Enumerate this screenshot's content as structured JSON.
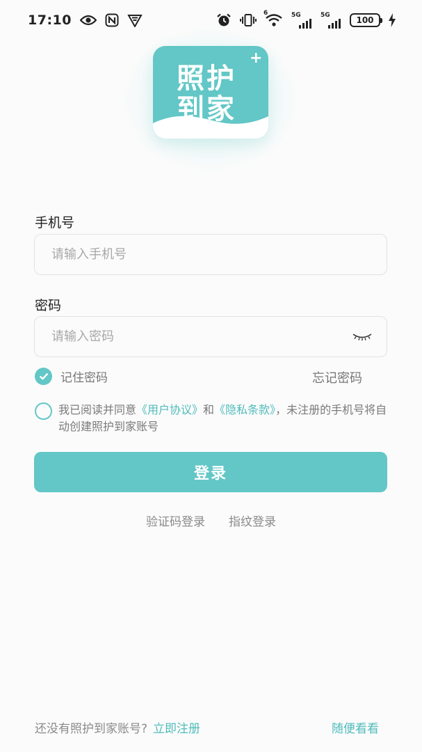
{
  "status_bar": {
    "time": "17:10",
    "net1": "5G",
    "net2": "5G",
    "wifi_sup": "6",
    "battery": "100",
    "icons": [
      "eye-icon",
      "nfc-icon",
      "vpn-shield-icon",
      "alarm-icon",
      "vibrate-icon",
      "wifi-icon",
      "signal-icon",
      "signal-icon",
      "battery-icon",
      "charging-icon"
    ]
  },
  "logo": {
    "line1": "照护",
    "line2": "到家",
    "plus": "+",
    "color": "#62c7c6"
  },
  "form": {
    "phone_label": "手机号",
    "phone_placeholder": "请输入手机号",
    "phone_value": "",
    "password_label": "密码",
    "password_placeholder": "请输入密码",
    "password_value": "",
    "remember_label": "记住密码",
    "remember_checked": true,
    "forgot_label": "忘记密码"
  },
  "agreement": {
    "checked": false,
    "prefix": "我已阅读并同意",
    "user_agreement": "《用户协议》",
    "and": "和",
    "privacy": "《隐私条款》",
    "suffix": "，未注册的手机号将自动创建照护到家账号"
  },
  "actions": {
    "login": "登录",
    "sms_login": "验证码登录",
    "fingerprint_login": "指纹登录"
  },
  "footer": {
    "no_account": "还没有照护到家账号?",
    "register": "立即注册",
    "browse": "随便看看"
  },
  "colors": {
    "accent": "#62c7c6",
    "link": "#4fbcbb",
    "background": "#fbfbfb"
  }
}
